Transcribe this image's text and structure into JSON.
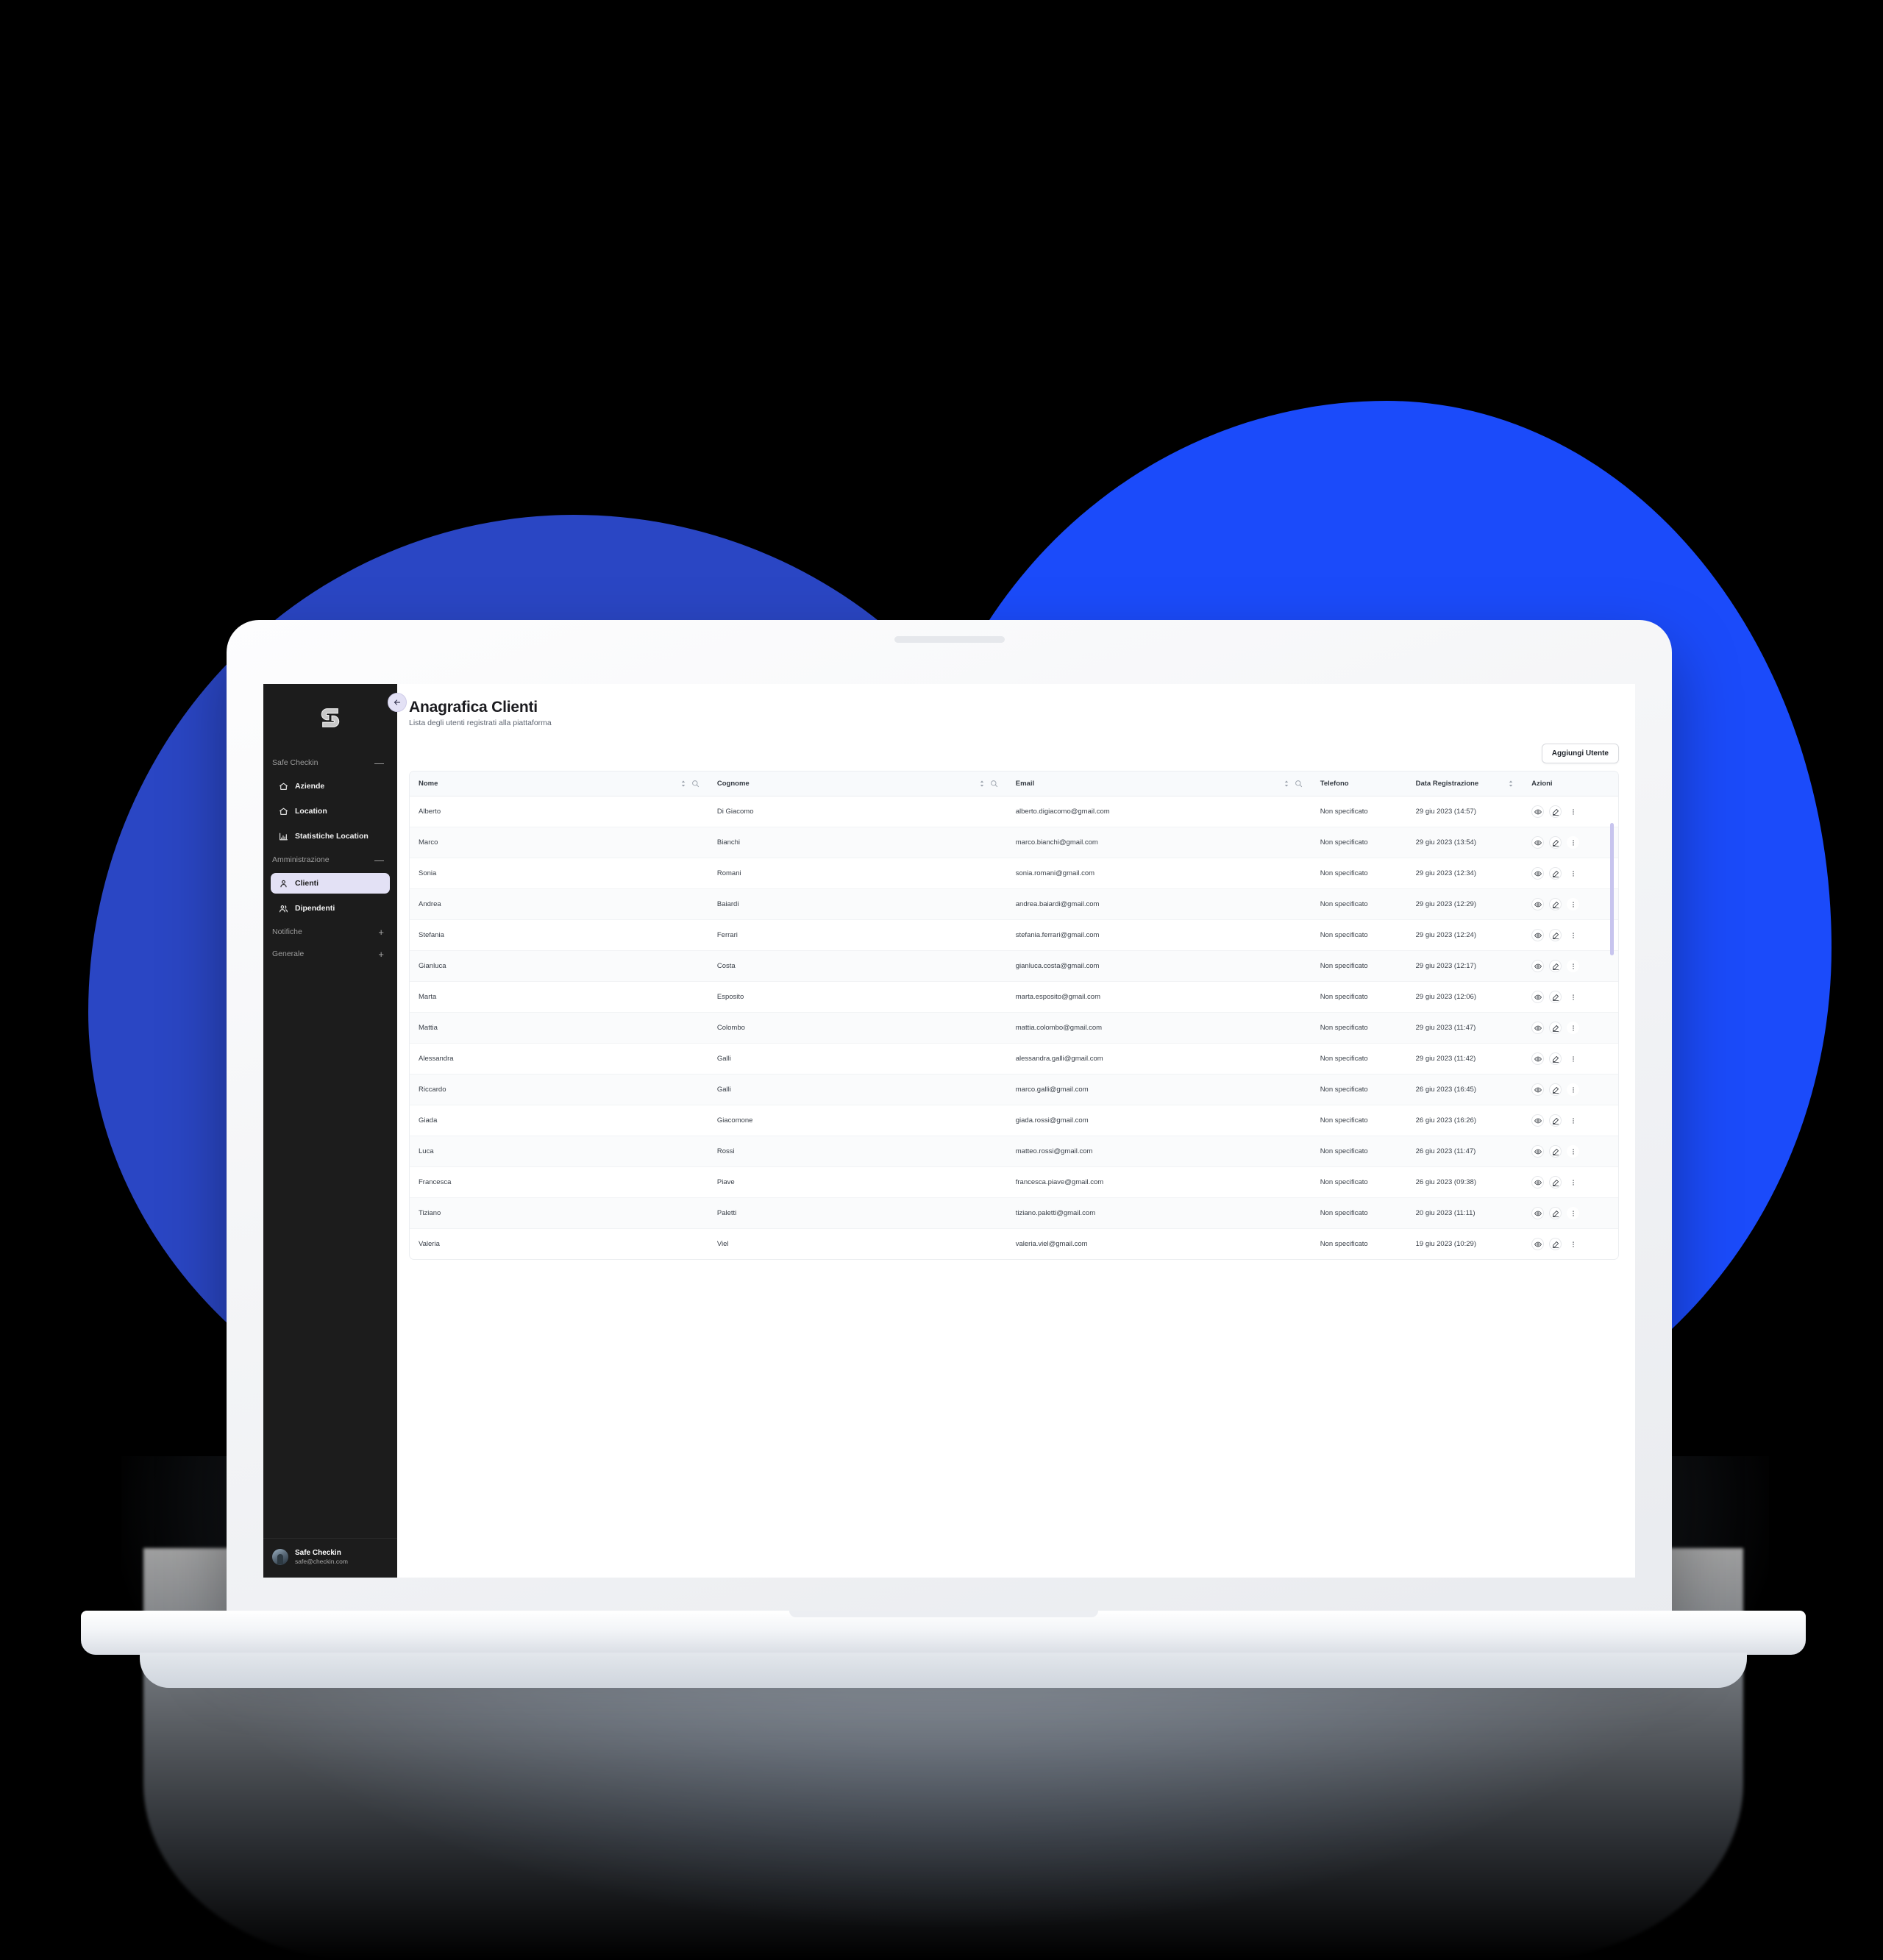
{
  "sidebar": {
    "logo_name": "safe-checkin-logo",
    "collapse_label": "←",
    "sections": [
      {
        "label": "Safe Checkin",
        "toggle": "—",
        "items": [
          {
            "label": "Aziende",
            "icon": "home-icon",
            "active": false
          },
          {
            "label": "Location",
            "icon": "home-icon",
            "active": false
          },
          {
            "label": "Statistiche Location",
            "icon": "bar-chart-icon",
            "active": false
          }
        ]
      },
      {
        "label": "Amministrazione",
        "toggle": "—",
        "items": [
          {
            "label": "Clienti",
            "icon": "user-icon",
            "active": true
          },
          {
            "label": "Dipendenti",
            "icon": "users-icon",
            "active": false
          }
        ]
      },
      {
        "label": "Notifiche",
        "toggle": "+",
        "items": []
      },
      {
        "label": "Generale",
        "toggle": "+",
        "items": []
      }
    ],
    "profile": {
      "name": "Safe Checkin",
      "email": "safe@checkin.com"
    }
  },
  "header": {
    "title": "Anagrafica Clienti",
    "subtitle": "Lista degli utenti registrati alla piattaforma"
  },
  "toolbar": {
    "add_user_label": "Aggiungi Utente"
  },
  "table": {
    "columns": [
      {
        "key": "nome",
        "label": "Nome",
        "sortable": true,
        "searchable": true
      },
      {
        "key": "cognome",
        "label": "Cognome",
        "sortable": true,
        "searchable": true
      },
      {
        "key": "email",
        "label": "Email",
        "sortable": true,
        "searchable": true
      },
      {
        "key": "telefono",
        "label": "Telefono",
        "sortable": false,
        "searchable": false
      },
      {
        "key": "data",
        "label": "Data Registrazione",
        "sortable": true,
        "searchable": false
      },
      {
        "key": "azioni",
        "label": "Azioni",
        "sortable": false,
        "searchable": false
      }
    ],
    "rows": [
      {
        "nome": "Alberto",
        "cognome": "Di Giacomo",
        "email": "alberto.digiacomo@gmail.com",
        "telefono": "Non specificato",
        "data": "29 giu 2023 (14:57)"
      },
      {
        "nome": "Marco",
        "cognome": "Bianchi",
        "email": "marco.bianchi@gmail.com",
        "telefono": "Non specificato",
        "data": "29 giu 2023 (13:54)"
      },
      {
        "nome": "Sonia",
        "cognome": "Romani",
        "email": "sonia.romani@gmail.com",
        "telefono": "Non specificato",
        "data": "29 giu 2023 (12:34)"
      },
      {
        "nome": "Andrea",
        "cognome": "Baiardi",
        "email": "andrea.baiardi@gmail.com",
        "telefono": "Non specificato",
        "data": "29 giu 2023 (12:29)"
      },
      {
        "nome": "Stefania",
        "cognome": "Ferrari",
        "email": "stefania.ferrari@gmail.com",
        "telefono": "Non specificato",
        "data": "29 giu 2023 (12:24)"
      },
      {
        "nome": "Gianluca",
        "cognome": "Costa",
        "email": "gianluca.costa@gmail.com",
        "telefono": "Non specificato",
        "data": "29 giu 2023 (12:17)"
      },
      {
        "nome": "Marta",
        "cognome": "Esposito",
        "email": "marta.esposito@gmail.com",
        "telefono": "Non specificato",
        "data": "29 giu 2023 (12:06)"
      },
      {
        "nome": "Mattia",
        "cognome": "Colombo",
        "email": "mattia.colombo@gmail.com",
        "telefono": "Non specificato",
        "data": "29 giu 2023 (11:47)"
      },
      {
        "nome": "Alessandra",
        "cognome": "Galli",
        "email": "alessandra.galli@gmail.com",
        "telefono": "Non specificato",
        "data": "29 giu 2023 (11:42)"
      },
      {
        "nome": "Riccardo",
        "cognome": "Galli",
        "email": "marco.galli@gmail.com",
        "telefono": "Non specificato",
        "data": "26 giu 2023 (16:45)"
      },
      {
        "nome": "Giada",
        "cognome": "Giacomone",
        "email": "giada.rossi@gmail.com",
        "telefono": "Non specificato",
        "data": "26 giu 2023 (16:26)"
      },
      {
        "nome": "Luca",
        "cognome": "Rossi",
        "email": "matteo.rossi@gmail.com",
        "telefono": "Non specificato",
        "data": "26 giu 2023 (11:47)"
      },
      {
        "nome": "Francesca",
        "cognome": "Piave",
        "email": "francesca.piave@gmail.com",
        "telefono": "Non specificato",
        "data": "26 giu 2023 (09:38)"
      },
      {
        "nome": "Tiziano",
        "cognome": "Paletti",
        "email": "tiziano.paletti@gmail.com",
        "telefono": "Non specificato",
        "data": "20 giu 2023 (11:11)"
      },
      {
        "nome": "Valeria",
        "cognome": "Viel",
        "email": "valeria.viel@gmail.com",
        "telefono": "Non specificato",
        "data": "19 giu 2023 (10:29)"
      }
    ],
    "row_actions": [
      {
        "name": "view-icon",
        "title": "Visualizza"
      },
      {
        "name": "edit-icon",
        "title": "Modifica"
      },
      {
        "name": "more-icon",
        "title": "Altro"
      }
    ]
  },
  "colors": {
    "sidebar_bg": "#1c1c1c",
    "accent_lilac": "#e3e1f5",
    "blob_blue_dark": "#2a46c4",
    "blob_blue_bright": "#1b4bfa",
    "page_bg": "#000000",
    "scrollbar": "#c7c4ee"
  }
}
